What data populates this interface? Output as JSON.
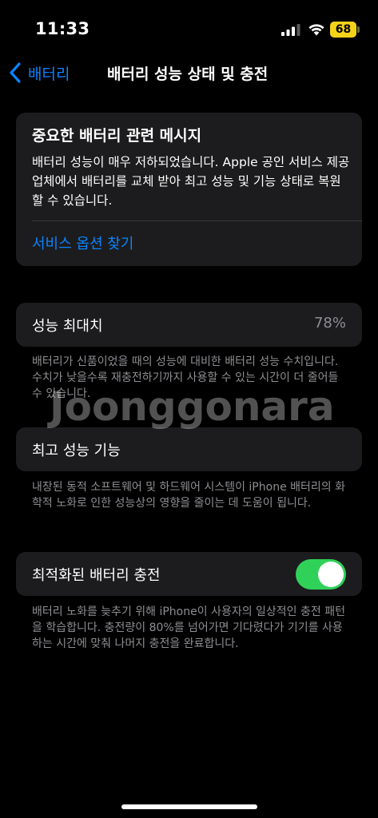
{
  "status_bar": {
    "time": "11:33",
    "battery_percent": "68",
    "battery_color": "#f4d21a"
  },
  "nav": {
    "back_label": "배터리",
    "title": "배터리 성능 상태 및 충전",
    "back_icon": "chevron-left-icon"
  },
  "message_card": {
    "title": "중요한 배터리 관련 메시지",
    "body": "배터리 성능이 매우 저하되었습니다. Apple 공인 서비스 제공업체에서 배터리를 교체 받아 최고 성능 및 기능 상태로 복원할 수 있습니다.",
    "link": "서비스 옵션 찾기"
  },
  "max_capacity": {
    "label": "성능 최대치",
    "value": "78%",
    "footnote": "배터리가 신품이었을 때의 성능에 대비한 배터리 성능 수치입니다. 수치가 낮을수록 재충전하기까지 사용할 수 있는 시간이 더 줄어들 수 있습니다."
  },
  "peak_performance": {
    "label": "최고 성능 기능",
    "footnote": "내장된 동적 소프트웨어 및 하드웨어 시스템이 iPhone 배터리의 화학적 노화로 인한 성능상의 영향을 줄이는 데 도움이 됩니다."
  },
  "optimized_charging": {
    "label": "최적화된 배터리 충전",
    "toggle_on": true,
    "toggle_color": "#30d158",
    "footnote": "배터리 노화를 늦추기 위해 iPhone이 사용자의 일상적인 충전 패턴을 학습합니다. 충전량이 80%를 넘어가면 기다렸다가 기기를 사용하는 시간에 맞춰 나머지 충전을 완료합니다."
  },
  "watermark": "Joonggonara",
  "accent_color": "#0a84ff"
}
